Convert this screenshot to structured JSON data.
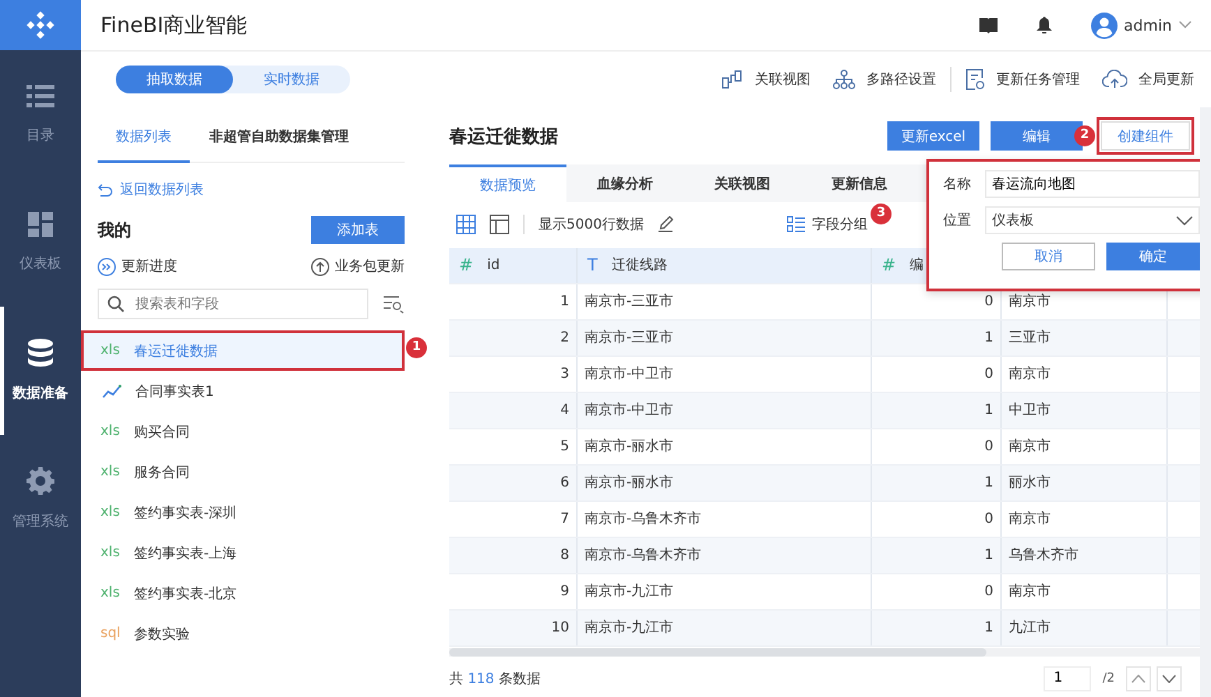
{
  "app": {
    "title": "FineBI商业智能",
    "user": "admin"
  },
  "nav": [
    {
      "label": "目录",
      "selected": false
    },
    {
      "label": "仪表板",
      "selected": false
    },
    {
      "label": "数据准备",
      "selected": true
    },
    {
      "label": "管理系统",
      "selected": false
    }
  ],
  "mode_switch": [
    {
      "label": "抽取数据",
      "selected": true
    },
    {
      "label": "实时数据",
      "selected": false
    }
  ],
  "toolbar_links": [
    "关联视图",
    "多路径设置",
    "更新任务管理",
    "全局更新"
  ],
  "left_panel": {
    "tabs": [
      {
        "label": "数据列表",
        "selected": true
      },
      {
        "label": "非超管自助数据集管理",
        "selected": false
      }
    ],
    "back_link": "返回数据列表",
    "section_title": "我的",
    "add_button": "添加表",
    "actions": [
      "更新进度",
      "业务包更新"
    ],
    "search": {
      "placeholder": "搜索表和字段"
    },
    "items": [
      {
        "kind": "file",
        "tag": "xls",
        "name": "春运迁徙数据",
        "selected": true,
        "highlighted": true,
        "annotation": "1"
      },
      {
        "kind": "analysis",
        "name": "合同事实表1",
        "selected": false
      },
      {
        "kind": "file",
        "tag": "xls",
        "name": "购买合同",
        "selected": false
      },
      {
        "kind": "file",
        "tag": "xls",
        "name": "服务合同",
        "selected": false
      },
      {
        "kind": "file",
        "tag": "xls",
        "name": "签约事实表-深圳",
        "selected": false
      },
      {
        "kind": "file",
        "tag": "xls",
        "name": "签约事实表-上海",
        "selected": false
      },
      {
        "kind": "file",
        "tag": "xls",
        "name": "签约事实表-北京",
        "selected": false
      },
      {
        "kind": "sql",
        "tag": "sql",
        "name": "参数实验",
        "selected": false
      }
    ]
  },
  "dataset": {
    "title": "春运迁徙数据",
    "buttons": [
      {
        "label": "更新excel",
        "kind": "primary"
      },
      {
        "label": "编辑",
        "kind": "primary",
        "annotation": "2"
      },
      {
        "label": "创建组件",
        "kind": "outline",
        "highlighted": true
      }
    ],
    "tabs": [
      {
        "label": "数据预览",
        "selected": true
      },
      {
        "label": "血缘分析",
        "selected": false
      },
      {
        "label": "关联视图",
        "selected": false
      },
      {
        "label": "更新信息",
        "selected": false
      }
    ],
    "row_limit": "显示5000行数据",
    "group_button": {
      "label": "字段分组",
      "annotation": "3"
    },
    "table": {
      "columns": [
        {
          "kind": "number",
          "type_mark": "#",
          "label": "id"
        },
        {
          "kind": "text",
          "type_mark": "T",
          "label": "迁徙线路"
        },
        {
          "kind": "number",
          "type_mark": "#",
          "label": "编"
        }
      ],
      "rows": [
        [
          "1",
          "南京市-三亚市",
          "0",
          "南京市"
        ],
        [
          "2",
          "南京市-三亚市",
          "1",
          "三亚市"
        ],
        [
          "3",
          "南京市-中卫市",
          "0",
          "南京市"
        ],
        [
          "4",
          "南京市-中卫市",
          "1",
          "中卫市"
        ],
        [
          "5",
          "南京市-丽水市",
          "0",
          "南京市"
        ],
        [
          "6",
          "南京市-丽水市",
          "1",
          "丽水市"
        ],
        [
          "7",
          "南京市-乌鲁木齐市",
          "0",
          "南京市"
        ],
        [
          "8",
          "南京市-乌鲁木齐市",
          "1",
          "乌鲁木齐市"
        ],
        [
          "9",
          "南京市-九江市",
          "0",
          "南京市"
        ],
        [
          "10",
          "南京市-九江市",
          "1",
          "九江市"
        ]
      ]
    },
    "total": {
      "prefix": "共",
      "count": "118",
      "suffix": "条数据"
    },
    "pager": {
      "page": "1",
      "pages": "/2"
    }
  },
  "create_popup": {
    "highlighted": true,
    "fields": [
      {
        "label": "名称",
        "kind": "input",
        "value": "春运流向地图"
      },
      {
        "label": "位置",
        "kind": "select",
        "value": "仪表板"
      }
    ],
    "cancel": "取消",
    "confirm": "确定"
  }
}
